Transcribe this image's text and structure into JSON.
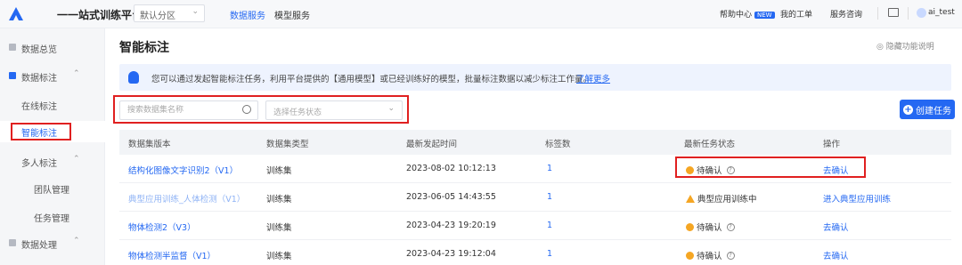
{
  "topbar": {
    "platform_title": "一一站式训练平台",
    "zone_select": "默认分区",
    "nav": [
      "数据服务",
      "模型服务"
    ],
    "help_center": "帮助中心",
    "new_badge": "NEW",
    "my_tickets": "我的工单",
    "service_consult": "服务咨询",
    "user_name": "ai_test"
  },
  "sidebar": {
    "items": [
      {
        "label": "数据总览"
      },
      {
        "label": "数据标注"
      },
      {
        "label": "在线标注"
      },
      {
        "label": "智能标注"
      },
      {
        "label": "多人标注"
      },
      {
        "label": "团队管理"
      },
      {
        "label": "任务管理"
      },
      {
        "label": "数据处理"
      }
    ]
  },
  "main": {
    "title": "智能标注",
    "hide_help": "隐藏功能说明",
    "banner_text": "您可以通过发起智能标注任务，利用平台提供的【通用模型】或已经训练好的模型，批量标注数据以减少标注工作量。",
    "banner_more": "了解更多",
    "search_placeholder": "搜索数据集名称",
    "status_placeholder": "选择任务状态",
    "create_label": "创建任务"
  },
  "table": {
    "headers": [
      "数据集版本",
      "数据集类型",
      "最新发起时间",
      "标签数",
      "最新任务状态",
      "操作"
    ],
    "rows": [
      {
        "dataset": "结构化图像文字识别2（V1）",
        "type": "训练集",
        "time": "2023-08-02 10:12:13",
        "labels": "1",
        "status": "待确认",
        "action": "去确认"
      },
      {
        "dataset": "典型应用训练_人体检测（V1）",
        "type": "训练集",
        "time": "2023-06-05 14:43:55",
        "labels": "1",
        "status": "典型应用训练中",
        "action": "进入典型应用训练"
      },
      {
        "dataset": "物体检测2（V3）",
        "type": "训练集",
        "time": "2023-04-23 19:20:19",
        "labels": "1",
        "status": "待确认",
        "action": "去确认"
      },
      {
        "dataset": "物体检测半监督（V1）",
        "type": "训练集",
        "time": "2023-04-23 19:12:04",
        "labels": "1",
        "status": "待确认",
        "action": "去确认"
      }
    ]
  },
  "colors": {
    "accent": "#2468f2",
    "warning": "#f5a623",
    "highlight": "#e02020"
  }
}
